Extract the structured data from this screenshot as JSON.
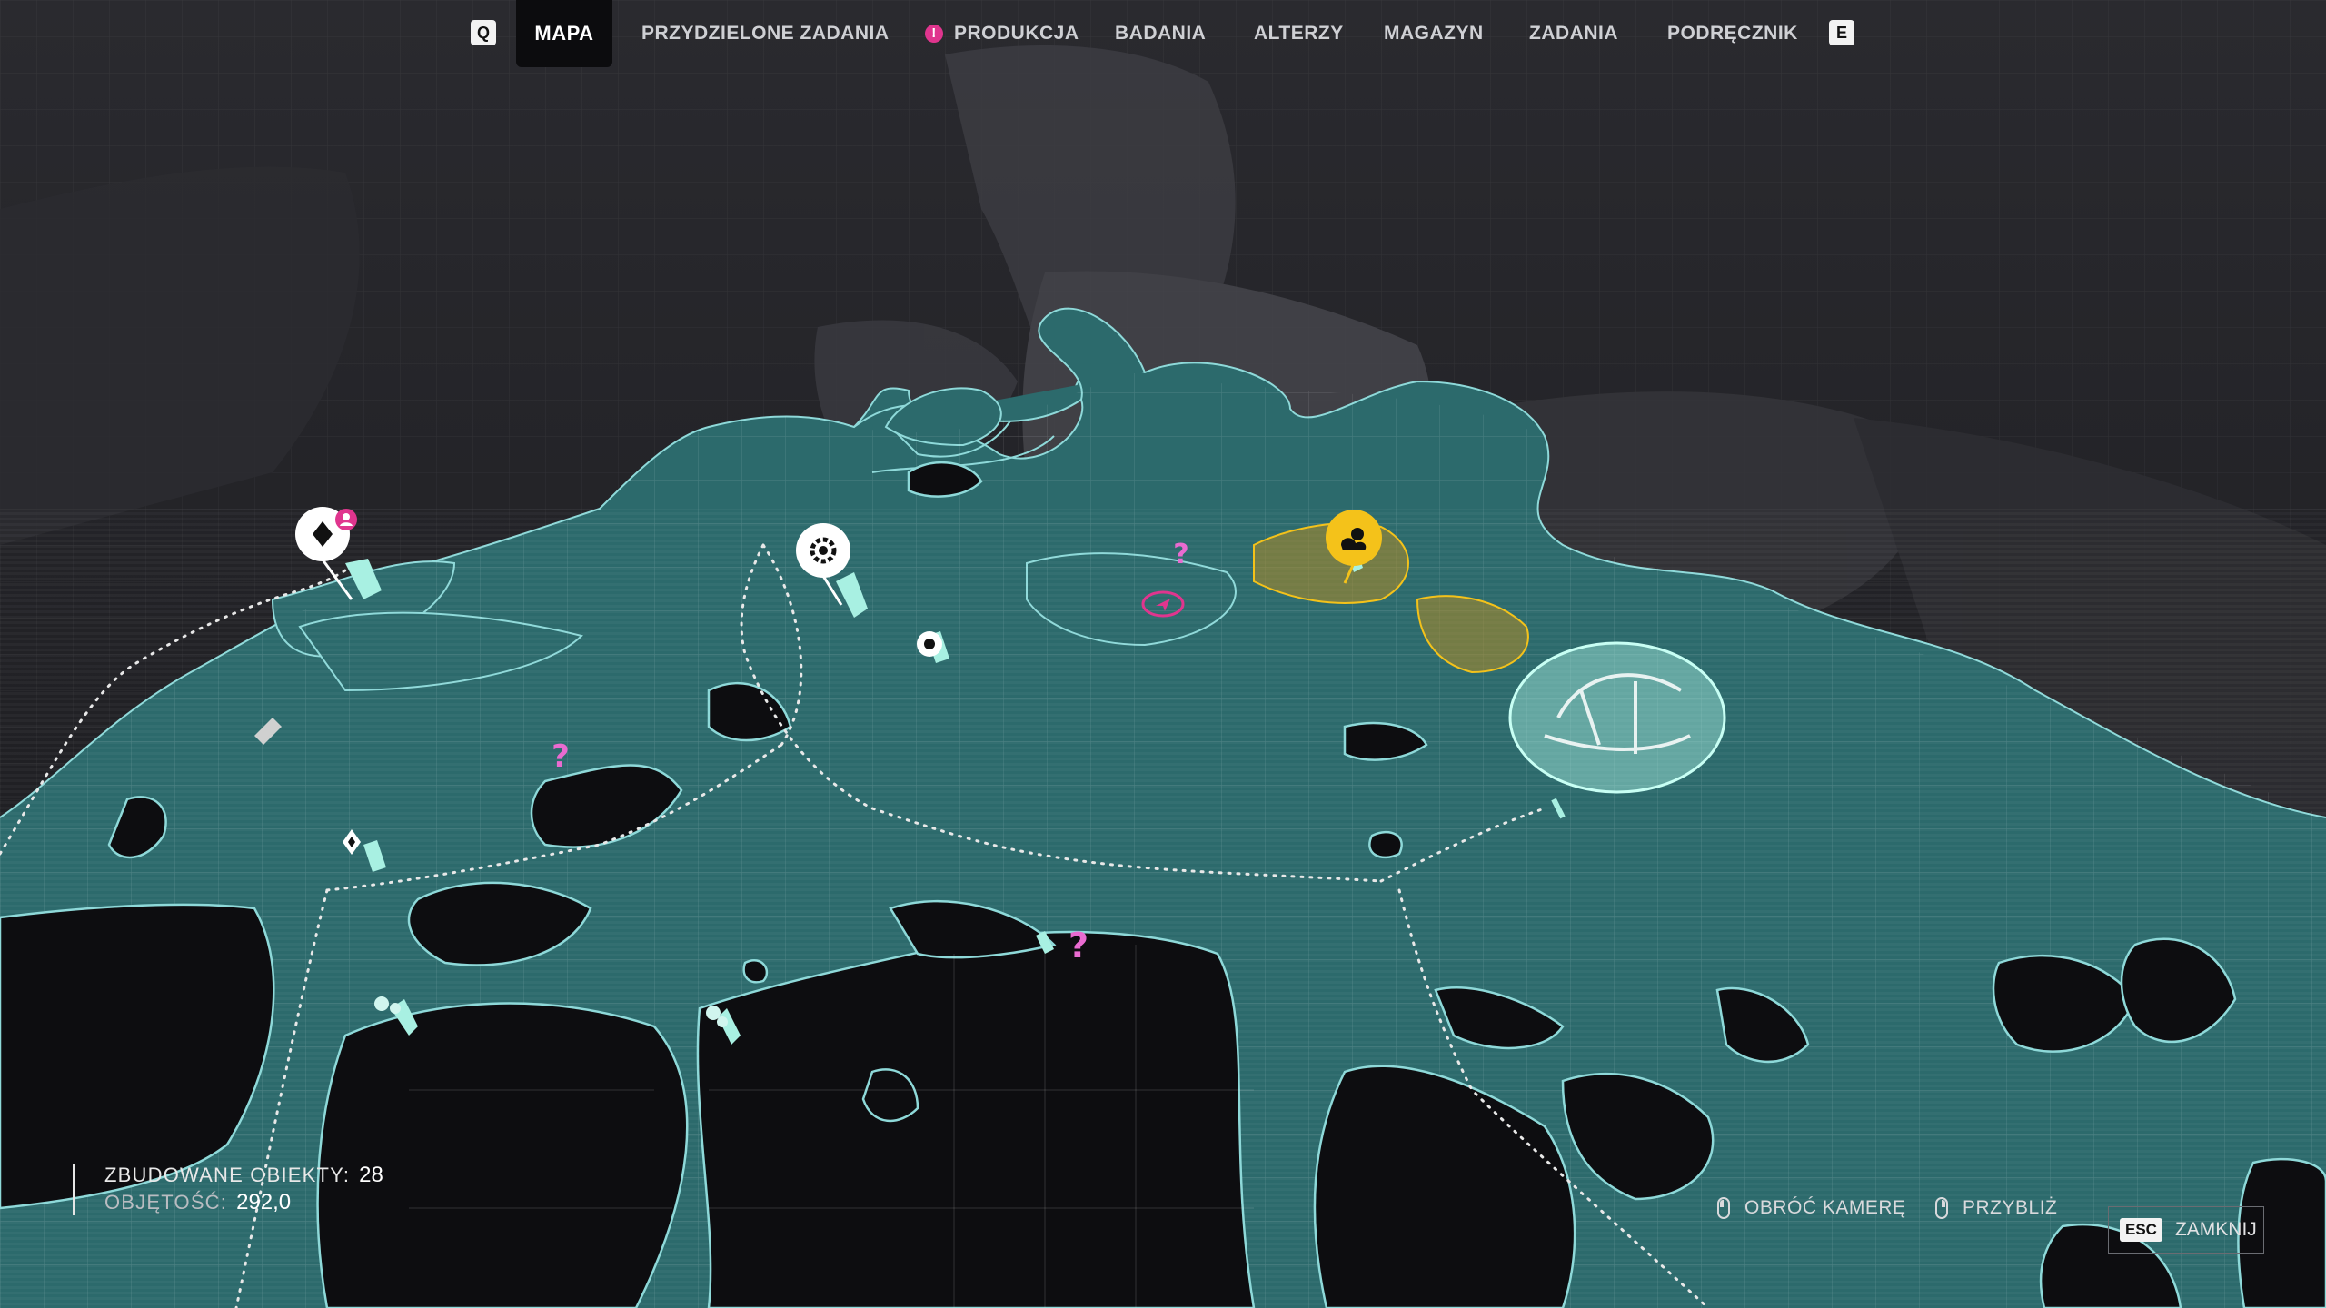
{
  "nav": {
    "prev_key": "Q",
    "next_key": "E",
    "alert_icon": "!",
    "tabs": [
      {
        "label": "MAPA",
        "active": true
      },
      {
        "label": "PRZYDZIELONE ZADANIA"
      },
      {
        "label": "PRODUKCJA",
        "alert": true
      },
      {
        "label": "BADANIA"
      },
      {
        "label": "ALTERZY"
      },
      {
        "label": "MAGAZYN"
      },
      {
        "label": "ZADANIA"
      },
      {
        "label": "PODRĘCZNIK"
      }
    ]
  },
  "map": {
    "unknown_marker": "?",
    "colors": {
      "water": "#2c6a6c",
      "water_edge": "#8ed9d9",
      "rock": "#3a3a40",
      "highlight": "#f4c21a",
      "quest": "#e96bd0",
      "building": "#a8f0e2"
    },
    "markers": [
      {
        "icon": "diamond-waypoint-icon",
        "badge": "person-icon"
      },
      {
        "icon": "gear-icon"
      },
      {
        "icon": "gear-icon"
      },
      {
        "icon": "sun-cloud-icon"
      },
      {
        "icon": "player-position-icon"
      },
      {
        "icon": "question-mark-icon"
      },
      {
        "icon": "diamond-waypoint-icon"
      }
    ]
  },
  "stats": {
    "built_label": "ZBUDOWANE OBIEKTY:",
    "built_value": "28",
    "volume_label": "OBJĘTOŚĆ:",
    "volume_value": "292,0"
  },
  "hints": {
    "rotate": "OBRÓĆ KAMERĘ",
    "zoom": "PRZYBLIŻ",
    "close_key": "ESC",
    "close": "ZAMKNIJ"
  }
}
